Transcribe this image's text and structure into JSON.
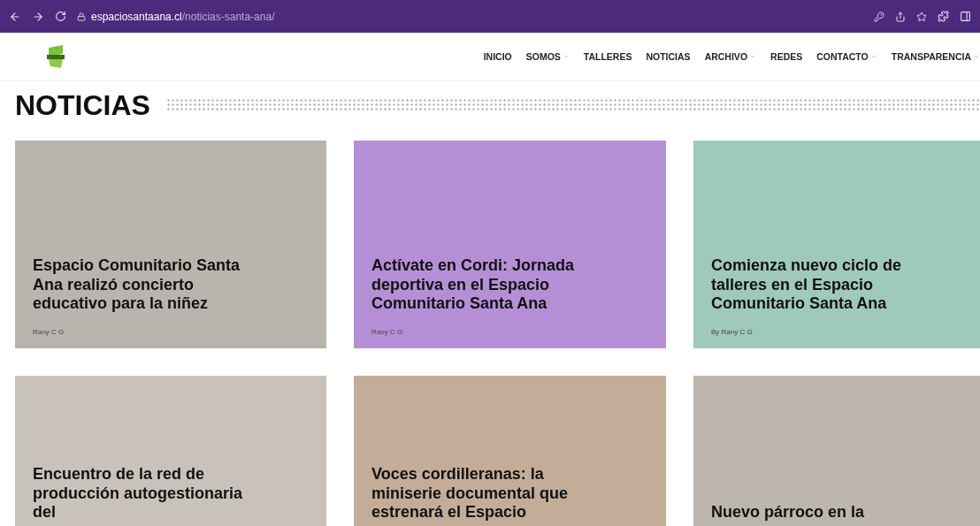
{
  "browser": {
    "url_host": "espaciosantaana.cl",
    "url_path": "/noticias-santa-ana/"
  },
  "nav": [
    {
      "label": "INICIO",
      "has_submenu": false
    },
    {
      "label": "SOMOS",
      "has_submenu": true
    },
    {
      "label": "TALLERES",
      "has_submenu": false
    },
    {
      "label": "NOTICIAS",
      "has_submenu": false
    },
    {
      "label": "ARCHIVO",
      "has_submenu": true
    },
    {
      "label": "REDES",
      "has_submenu": false
    },
    {
      "label": "CONTACTO",
      "has_submenu": true
    },
    {
      "label": "TRANSPARENCIA",
      "has_submenu": true
    }
  ],
  "page_title": "NOTICIAS",
  "posts": [
    {
      "title": "Espacio Comunitario Santa Ana realizó concierto educativo para la niñez",
      "author": "Rany C G",
      "color": "#b9b4ad"
    },
    {
      "title": "Actívate en Cordi: Jornada deportiva en el Espacio Comunitario Santa Ana",
      "author": "Rany C G",
      "color": "#b58fd6"
    },
    {
      "title": "Comienza nuevo ciclo de talleres en el Espacio Comunitario Santa Ana",
      "author": "By Rany C G",
      "color": "#9fc9b8"
    },
    {
      "title": "Encuentro de la red de producción autogestionaria del",
      "color": "#c9c2bb"
    },
    {
      "title": "Voces cordilleranas: la miniserie documental que estrenará el Espacio",
      "color": "#c4ad98"
    },
    {
      "title": "Nuevo párroco en la",
      "color": "#bdb6ae"
    }
  ]
}
